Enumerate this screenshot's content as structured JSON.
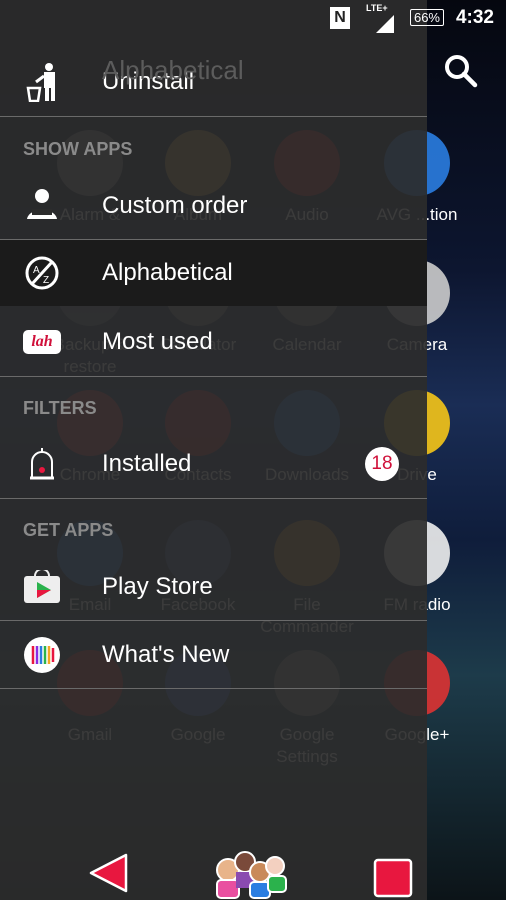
{
  "status_bar": {
    "nfc": "N",
    "network": "LTE+",
    "battery": "66%",
    "time": "4:32"
  },
  "background": {
    "title": "Alphabetical",
    "apps": [
      "Alarm &",
      "Album",
      "Audio",
      "AVG ...tion",
      "Backup & restore",
      "Calculator",
      "Calendar",
      "Camera",
      "Chrome",
      "Contacts",
      "Downloads",
      "Drive",
      "Email",
      "Facebook",
      "File Commander",
      "FM radio",
      "Gmail",
      "Google",
      "Google Settings",
      "Google+"
    ]
  },
  "drawer": {
    "uninstall": "Uninstall",
    "sections": {
      "show_apps": "SHOW APPS",
      "filters": "FILTERS",
      "get_apps": "GET APPS"
    },
    "items": {
      "custom_order": "Custom order",
      "alphabetical": "Alphabetical",
      "most_used": "Most used",
      "installed": "Installed",
      "installed_count": "18",
      "play_store": "Play Store",
      "whats_new": "What's New"
    },
    "selected": "alphabetical",
    "icons": {
      "most_used_text": "lah"
    }
  },
  "colors": {
    "accent": "#e8173f",
    "drawer": "#2c2c2c",
    "selected": "#1b1b1b"
  }
}
